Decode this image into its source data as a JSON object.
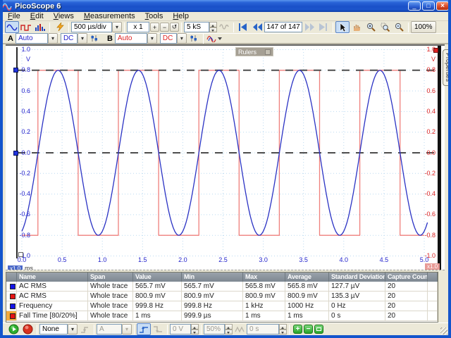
{
  "window": {
    "title": "PicoScope 6",
    "controls": {
      "minimize": "_",
      "maximize": "□",
      "close": "×"
    }
  },
  "menu": {
    "items": [
      "File",
      "Edit",
      "Views",
      "Measurements",
      "Tools",
      "Help"
    ]
  },
  "toolbar": {
    "timebase": "500 µs/div",
    "zoom_x": "x 1",
    "glyph_plus": "+",
    "glyph_minus": "−",
    "glyph_reset": "↺",
    "samples": "5 kS",
    "buffer_position": "147 of 147",
    "zoom_level": "100%"
  },
  "channels": {
    "a_label": "A",
    "a_range": "Auto",
    "a_coupling": "DC",
    "b_label": "B",
    "b_range": "Auto",
    "b_coupling": "DC"
  },
  "graph": {
    "rulers_box_label": "Rulers",
    "left_axis_unit": "V",
    "right_axis_unit": "V",
    "x_axis_unit": "ms",
    "y_ticks": [
      "1.0",
      "0.8",
      "0.6",
      "0.4",
      "0.2",
      "0.0",
      "-0.2",
      "-0.4",
      "-0.6",
      "-0.8",
      "-1.0"
    ],
    "x_ticks": [
      "0.0",
      "0.5",
      "1.0",
      "1.5",
      "2.0",
      "2.5",
      "3.0",
      "3.5",
      "4.0",
      "4.5",
      "5.0"
    ],
    "left_scale_badge": "x1.0",
    "right_scale_badge": "x1.0",
    "colors": {
      "channel_a": "#2b33c4",
      "channel_b": "#ef7f7c",
      "grid": "#b9d9f0",
      "ruler": "#4d4d4d"
    }
  },
  "chart_data": {
    "type": "line",
    "xlabel": "ms",
    "ylabel_left": "V",
    "ylabel_right": "V",
    "xlim": [
      0,
      5
    ],
    "ylim": [
      -1,
      1
    ],
    "x_tick_values": [
      0,
      0.5,
      1,
      1.5,
      2,
      2.5,
      3,
      3.5,
      4,
      4.5,
      5
    ],
    "y_tick_values": [
      1,
      0.8,
      0.6,
      0.4,
      0.2,
      0,
      -0.2,
      -0.4,
      -0.6,
      -0.8,
      -1
    ],
    "series": [
      {
        "name": "Channel A sine",
        "color": "#2b33c4",
        "shape": "sine",
        "amplitude_V": 0.8,
        "frequency_kHz": 1,
        "phase_ms": 0.2,
        "t_end_ms": 5.04
      },
      {
        "name": "Channel B square",
        "color": "#ef7f7c",
        "shape": "square",
        "amplitude_V": 0.8,
        "high_intervals_ms": [
          [
            0.2,
            0.7
          ],
          [
            1.2,
            1.7
          ],
          [
            2.2,
            2.7
          ],
          [
            3.2,
            3.7
          ],
          [
            4.2,
            4.7
          ]
        ],
        "t_end_ms": 5.0
      }
    ],
    "rulers_channel_a_V": [
      0.8,
      0.0
    ],
    "grid": true
  },
  "properties_tab": "Properties",
  "measurements": {
    "headers": [
      "Name",
      "Span",
      "Value",
      "Min",
      "Max",
      "Average",
      "Standard Deviation",
      "Capture Count"
    ],
    "dock_minimize": "_",
    "dock_maximize": "□",
    "add_glyph": "+",
    "delete_glyph": "−",
    "rows": [
      {
        "color": "#1414e6",
        "name": "AC RMS",
        "span": "Whole trace",
        "value": "565.7 mV",
        "min": "565.7 mV",
        "max": "565.8 mV",
        "average": "565.8 mV",
        "std_dev": "127.7 µV",
        "capture_count": "20",
        "selected": false
      },
      {
        "color": "#e61414",
        "name": "AC RMS",
        "span": "Whole trace",
        "value": "800.9 mV",
        "min": "800.9 mV",
        "max": "800.9 mV",
        "average": "800.9 mV",
        "std_dev": "135.3 µV",
        "capture_count": "20",
        "selected": false
      },
      {
        "color": "#1414e6",
        "name": "Frequency",
        "span": "Whole trace",
        "value": "999.8 Hz",
        "min": "999.8 Hz",
        "max": "1 kHz",
        "average": "1000 Hz",
        "std_dev": "0 Hz",
        "capture_count": "20",
        "selected": false
      },
      {
        "color": "#e61414",
        "name": "Fall Time  [80/20%]",
        "span": "Whole trace",
        "value": "1 ms",
        "min": "999.9 µs",
        "max": "1 ms",
        "average": "1 ms",
        "std_dev": "0 s",
        "capture_count": "20",
        "selected": true
      }
    ]
  },
  "trigger": {
    "mode": "None",
    "source": "A",
    "level": "0 V",
    "pretrigger": "50%",
    "delay": "0 s"
  }
}
